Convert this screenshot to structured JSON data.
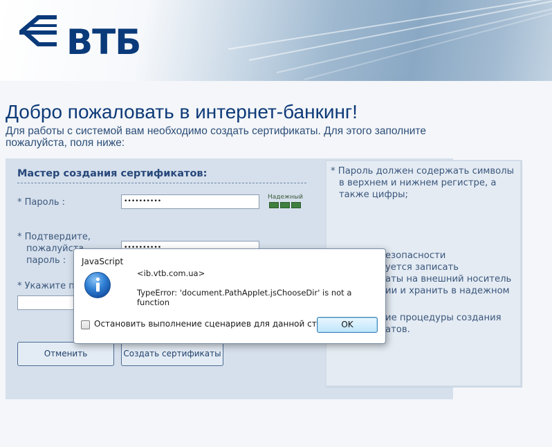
{
  "header": {
    "logo_text": "ВТБ",
    "logo_icon": "vtb-wings-logo"
  },
  "welcome": {
    "title": "Добро пожаловать в интернет-банкинг!",
    "intro_line1": "Для работы с системой вам необходимо создать сертификаты. Для этого заполните",
    "intro_line2": "пожалуйста, поля ниже:"
  },
  "wizard": {
    "title": "Мастер создания сертификатов:",
    "password_label": "* Пароль :",
    "password_value": "••••••••••",
    "strength_label": "Надежный",
    "strength_level": "3/3",
    "confirm_line1": "* Подтвердите,",
    "confirm_line2": "пожалуйста",
    "confirm_line3": "пароль :",
    "confirm_value": "••••••••••",
    "path_label": "* Укажите п",
    "path_value": "",
    "cancel_label": "Отменить",
    "create_label": "Создать сертификаты"
  },
  "hint": {
    "line1": "* Пароль должен содержать символы",
    "line2": "в верхнем и нижнем регистре, а",
    "line3": "также цифры;",
    "line4": "езопасности",
    "line5": "уется записать",
    "line6": "аты на внешний носитель",
    "line7": "ии и хранить в надежном",
    "line8": "ие процедуры создания",
    "line9": "атов."
  },
  "dialog": {
    "title": "JavaScript",
    "icon": "info-icon",
    "origin": "<ib.vtb.com.ua>",
    "message_line1": "TypeError: 'document.PathApplet.jsChooseDir' is not a",
    "message_line2": "function",
    "checkbox_label": "Остановить выполнение сценариев для данной страницы",
    "checkbox_checked": false,
    "ok_label": "OK"
  },
  "colors": {
    "brand": "#0a3a7a",
    "panel": "#d6e0ec",
    "strength": "#3f7f3f"
  }
}
